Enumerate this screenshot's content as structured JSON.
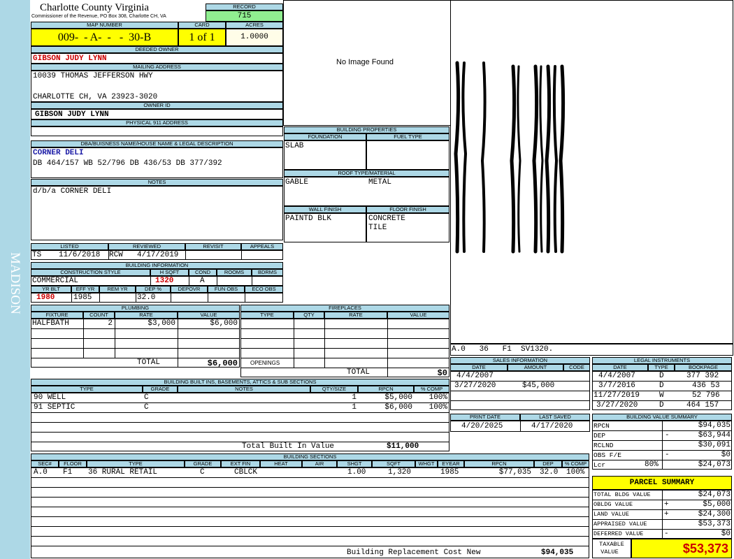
{
  "side_label": "MADISON",
  "county": "Charlotte County Virginia",
  "commissioner": "Commissioner of the Revenue, PO Box 308, Charlotte CH, VA",
  "record_label": "RECORD",
  "record_value": "715",
  "map_number_label": "MAP NUMBER",
  "map_number": "009-  - A-  -   -  30-B",
  "card_label": "CARD",
  "card_value": "1 of 1",
  "acres_label": "ACRES",
  "acres_value": "1.0000",
  "deeded_owner_label": "DEEDED OWNER",
  "deeded_owner": "GIBSON JUDY LYNN",
  "mailing_label": "MAILING ADDRESS",
  "mailing_line1": "10039 THOMAS JEFFERSON HWY",
  "mailing_line2": "CHARLOTTE CH, VA 23923-3020",
  "owner_id_label": "OWNER ID",
  "owner_id": "GIBSON JUDY LYNN",
  "physical_label": "PHYSICAL 911 ADDRESS",
  "dba_label": "DBA/BUISNESS NAME/HOUSE NAME & LEGAL DESCRIPTION",
  "dba_name": "CORNER DELI",
  "legal_desc": "DB 464/157 WB 52/796 DB 436/53 DB 377/392",
  "notes_label": "NOTES",
  "notes": "d/b/a CORNER DELI",
  "no_image": "No Image Found",
  "bp": {
    "title": "BUILDING PROPERTIES",
    "foundation_label": "FOUNDATION",
    "foundation": "SLAB",
    "fuel_label": "FUEL TYPE",
    "roof_label": "ROOF TYPE/MATERIAL",
    "roof_type": "GABLE",
    "roof_material": "METAL",
    "wall_label": "WALL FINISH",
    "wall": "PAINTD BLK",
    "floor_label": "FLOOR FINISH",
    "floor1": "CONCRETE",
    "floor2": "TILE"
  },
  "sketch_caption": "A.0   36   F1  SV1320.",
  "listed": {
    "listed_label": "LISTED",
    "reviewed_label": "REVIEWED",
    "revisit_label": "REVISIT",
    "appeals_label": "APPEALS",
    "listed_by": "TS",
    "listed_date": "11/6/2018",
    "reviewed_by": "RCW",
    "reviewed_date": "4/17/2019"
  },
  "bi": {
    "title": "BUILDING INFORMATION",
    "style_label": "CONSTRUCTION STYLE",
    "hsqft_label": "H SQFT",
    "cond_label": "COND",
    "rooms_label": "ROOMS",
    "bdrms_label": "BDRMS",
    "style": "COMMERCIAL",
    "hsqft": "1320",
    "cond": "A",
    "yrblt_label": "YR BLT",
    "effyr_label": "EFF YR",
    "remyr_label": "REM YR",
    "dep_label": "DEP %",
    "depovr_label": "DEPOVR",
    "funobs_label": "FUN OBS",
    "ecoobs_label": "ECO OBS",
    "yrblt": "1980",
    "effyr": "1985",
    "dep": "32.0"
  },
  "plumbing": {
    "title": "PLUMBING",
    "headers": [
      "FIXTURE",
      "COUNT",
      "RATE",
      "VALUE"
    ],
    "row": {
      "fixture": "HALFBATH",
      "count": "2",
      "rate": "$3,000",
      "value": "$6,000"
    },
    "total_label": "TOTAL",
    "total": "$6,000"
  },
  "fireplaces": {
    "title": "FIREPLACES",
    "headers": [
      "TYPE",
      "QTY",
      "RATE",
      "VALUE"
    ],
    "openings": "OPENINGS",
    "total_label": "TOTAL",
    "total": "$0"
  },
  "sales": {
    "title": "SALES INFORMATION",
    "headers": [
      "DATE",
      "AMOUNT",
      "CODE"
    ],
    "rows": [
      {
        "date": "4/4/2007",
        "amount": ""
      },
      {
        "date": "3/27/2020",
        "amount": "$45,000"
      }
    ]
  },
  "legal": {
    "title": "LEGAL INSTRUMENTS",
    "headers": [
      "DATE",
      "TYPE",
      "BOOKPAGE"
    ],
    "rows": [
      {
        "date": "4/4/2007",
        "type": "D",
        "book": "377 392"
      },
      {
        "date": "3/7/2016",
        "type": "D",
        "book": "436 53"
      },
      {
        "date": "11/27/2019",
        "type": "W",
        "book": "52 796"
      },
      {
        "date": "3/27/2020",
        "type": "D",
        "book": "464 157"
      }
    ]
  },
  "print": {
    "print_label": "PRINT DATE",
    "saved_label": "LAST SAVED",
    "print_date": "4/20/2025",
    "last_saved": "4/17/2020"
  },
  "builtins": {
    "title": "BUILDING BUILT INS, BASEMENTS, ATTICS & SUB SECTIONS",
    "headers": [
      "TYPE",
      "GRADE",
      "NOTES",
      "QTY/SIZE",
      "RPCN",
      "% COMP"
    ],
    "rows": [
      {
        "type": "90 WELL",
        "grade": "C",
        "qty": "1",
        "rpcn": "$5,000",
        "comp": "100%"
      },
      {
        "type": "91 SEPTIC",
        "grade": "C",
        "qty": "1",
        "rpcn": "$6,000",
        "comp": "100%"
      }
    ],
    "total_label": "Total Built In Value",
    "total": "$11,000"
  },
  "bvs": {
    "title": "BUILDING VALUE SUMMARY",
    "rows": [
      {
        "label": "RPCN",
        "op": "",
        "pct": "",
        "value": "$94,035"
      },
      {
        "label": "DEP",
        "op": "-",
        "pct": "",
        "value": "$63,944"
      },
      {
        "label": "RCLND",
        "op": "",
        "pct": "",
        "value": "$30,091"
      },
      {
        "label": "OBS F/E",
        "op": "-",
        "pct": "",
        "value": "$0"
      },
      {
        "label": "Lcr",
        "op": "",
        "pct": "80%",
        "value": "$24,073"
      }
    ]
  },
  "sections": {
    "title": "BUILDING SECTIONS",
    "headers": [
      "SEC#",
      "FLOOR",
      "TYPE",
      "GRADE",
      "EXT FIN",
      "HEAT",
      "AIR",
      "SHGT",
      "SQFT",
      "WHGT",
      "EYEAR",
      "RPCN",
      "DEP",
      "% COMP"
    ],
    "row": {
      "sec": "A.0",
      "floor": "F1",
      "type": "36 RURAL RETAIL",
      "grade": "C",
      "extfin": "CBLCK",
      "shgt": "1.00",
      "sqft": "1,320",
      "eyear": "1985",
      "rpcn": "$77,035",
      "dep": "32.0",
      "comp": "100%"
    },
    "replacement_label": "Building Replacement Cost New",
    "replacement_value": "$94,035"
  },
  "parcel": {
    "title": "PARCEL SUMMARY",
    "rows": [
      {
        "label": "TOTAL BLDG VALUE",
        "op": "",
        "value": "$24,073"
      },
      {
        "label": "OBLDG VALUE",
        "op": "+",
        "value": "$5,000"
      },
      {
        "label": "LAND VALUE",
        "op": "+",
        "value": "$24,300"
      },
      {
        "label": "APPRAISED VALUE",
        "op": "",
        "value": "$53,373"
      },
      {
        "label": "DEFERRED VALUE",
        "op": "-",
        "value": "$0"
      }
    ],
    "taxable_label_1": "TAXABLE",
    "taxable_label_2": "VALUE",
    "taxable_value": "$53,373"
  }
}
